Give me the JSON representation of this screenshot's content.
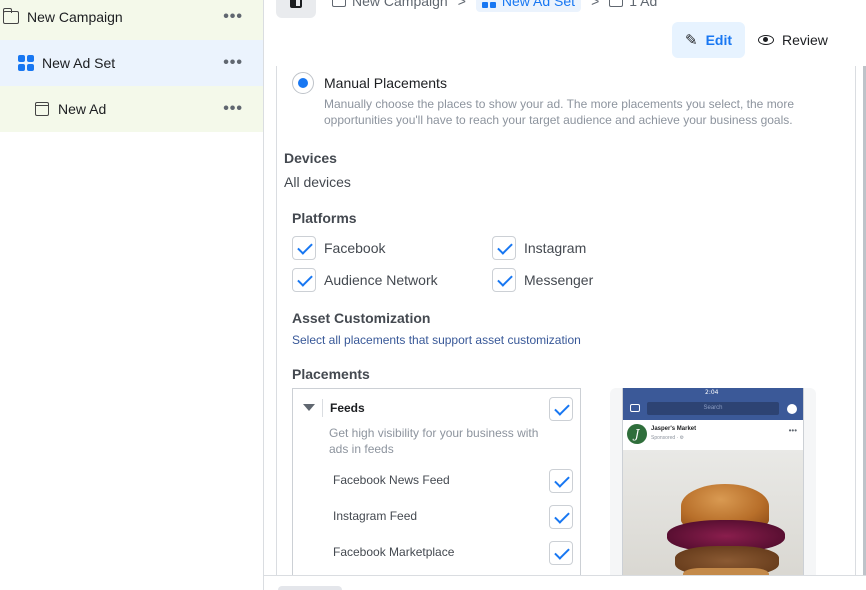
{
  "sidebar": {
    "campaign": {
      "label": "New Campaign",
      "more": "•••"
    },
    "adset": {
      "label": "New Ad Set",
      "more": "•••"
    },
    "ad": {
      "label": "New Ad",
      "more": "•••"
    }
  },
  "header": {
    "breadcrumbs": [
      "New Campaign",
      "New Ad Set",
      "1 Ad"
    ],
    "separator": ">",
    "edit_label": "Edit",
    "review_label": "Review"
  },
  "placements": {
    "manual_title": "Manual Placements",
    "manual_description": "Manually choose the places to show your ad. The more placements you select, the more opportunities you'll have to reach your target audience and achieve your business goals.",
    "devices_label": "Devices",
    "devices_value": "All devices",
    "platforms_label": "Platforms",
    "platforms": [
      "Facebook",
      "Instagram",
      "Audience Network",
      "Messenger"
    ],
    "asset_label": "Asset Customization",
    "asset_link": "Select all placements that support asset customization",
    "placements_label": "Placements",
    "feeds": {
      "title": "Feeds",
      "description": "Get high visibility for your business with ads in feeds",
      "items": [
        "Facebook News Feed",
        "Instagram Feed",
        "Facebook Marketplace"
      ]
    }
  },
  "preview": {
    "status_time": "2:04",
    "search_placeholder": "Search",
    "page_name": "Jasper's Market",
    "sponsored": "Sponsored · ⚙",
    "logo_letter": "J",
    "more": "•••"
  },
  "colors": {
    "accent": "#1877f2",
    "adset_bg": "#ebf3fd",
    "campaign_bg": "#f4f9ea",
    "fb_blue": "#3b5998"
  }
}
